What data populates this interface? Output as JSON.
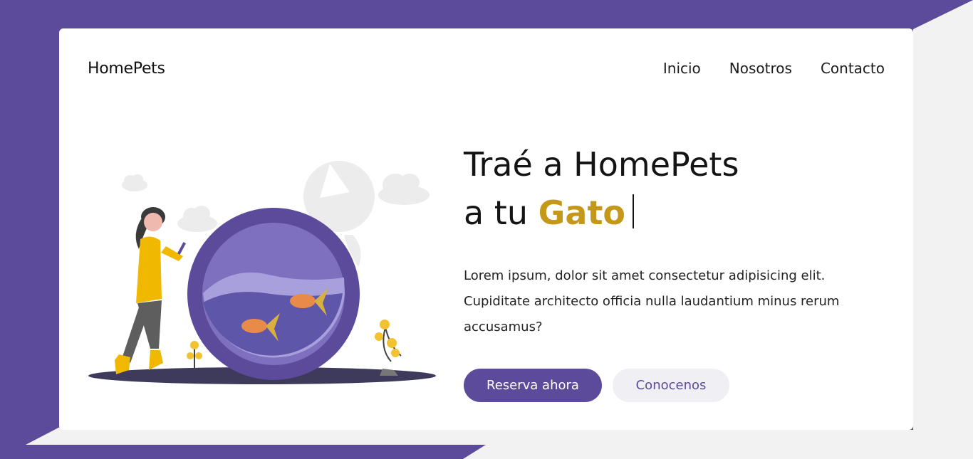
{
  "brand": {
    "name": "HomePets"
  },
  "nav": {
    "items": [
      "Inicio",
      "Nosotros",
      "Contacto"
    ]
  },
  "hero": {
    "title_line1": "Traé a HomePets",
    "title_line2_prefix": "a tu",
    "title_highlight": "Gato",
    "description": "Lorem ipsum, dolor sit amet consectetur adipisicing elit. Cupiditate architecto officia nulla laudantium minus rerum accusamus?",
    "primary_button": "Reserva ahora",
    "secondary_button": "Conocenos"
  },
  "illustration": {
    "subject": "woman-with-phone-next-to-fishbowl",
    "icons": [
      "cloud-icon",
      "fishbowl-icon",
      "goldfish-icon",
      "plant-icon",
      "moon-icon"
    ]
  },
  "colors": {
    "primary": "#5b4b9a",
    "accent": "#c4991a",
    "background": "#f2f2f2",
    "card": "#ffffff"
  }
}
